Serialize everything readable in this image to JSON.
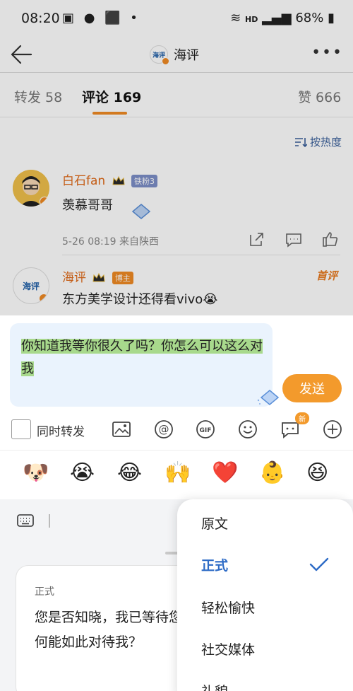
{
  "status": {
    "time": "08:20",
    "battery": "68%",
    "network": "HD"
  },
  "nav": {
    "title": "海评",
    "avatar_text": "海评"
  },
  "tabs": [
    {
      "label": "转发 58"
    },
    {
      "label": "评论 169"
    },
    {
      "label": "赞 666"
    }
  ],
  "sort_label": "按热度",
  "comments": [
    {
      "name": "白石fan",
      "badge": "铁粉3",
      "text": "羡慕哥哥",
      "meta": "5-26 08:19  来自陕西"
    },
    {
      "name": "海评",
      "badge": "博主",
      "text": "东方美学设计还得看vivo😭",
      "pin": "首评"
    }
  ],
  "composer": {
    "text": "你知道我等你很久了吗？你怎么可以这么对我",
    "send_label": "发送",
    "repost_label": "同时转发",
    "new_badge": "新"
  },
  "emojis": [
    "🐶",
    "😭",
    "😂",
    "🙌",
    "❤️",
    "👶",
    "😆"
  ],
  "result": {
    "label": "正式",
    "text": "您是否知晓，我已等待您许久？您如何能如此对待我？"
  },
  "menu": {
    "items": [
      {
        "label": "原文"
      },
      {
        "label": "正式"
      },
      {
        "label": "轻松愉快"
      },
      {
        "label": "社交媒体"
      },
      {
        "label": "礼貌"
      }
    ],
    "selected": "正式"
  },
  "colors": {
    "accent": "#f08a24",
    "link": "#2d6bc6",
    "highlight": "#a8d98c"
  }
}
